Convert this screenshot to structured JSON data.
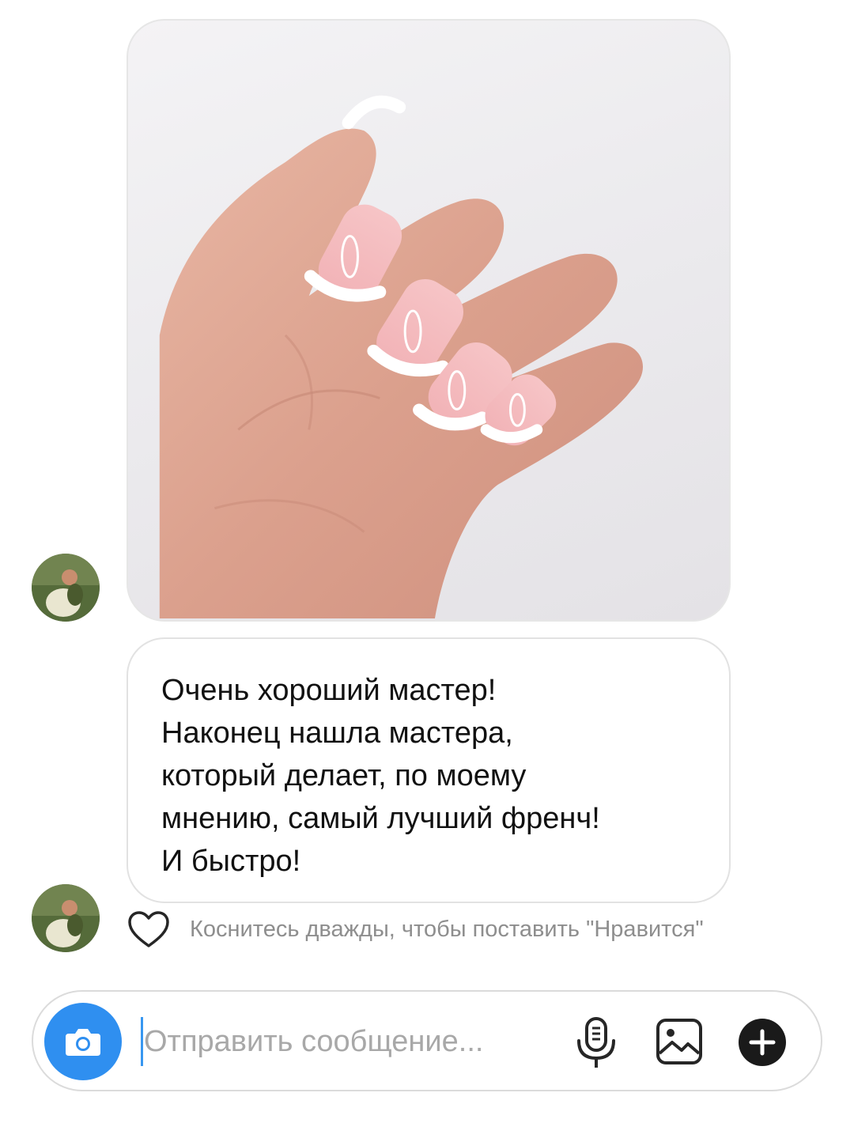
{
  "photo_message": {
    "icon": "nail-photo"
  },
  "text_message": {
    "text": "Очень хороший мастер!\nНаконец нашла мастера,\nкоторый делает, по моему\nмнению, самый лучший френч!\nИ быстро!"
  },
  "reaction": {
    "icon": "heart-icon",
    "hint": "Коснитесь дважды, чтобы поставить \"Нравится\""
  },
  "composer": {
    "placeholder": "Отправить сообщение...",
    "value": "",
    "icons": [
      "camera-icon",
      "microphone-icon",
      "gallery-icon",
      "plus-icon"
    ],
    "accent_color": "#2f8ff0"
  }
}
